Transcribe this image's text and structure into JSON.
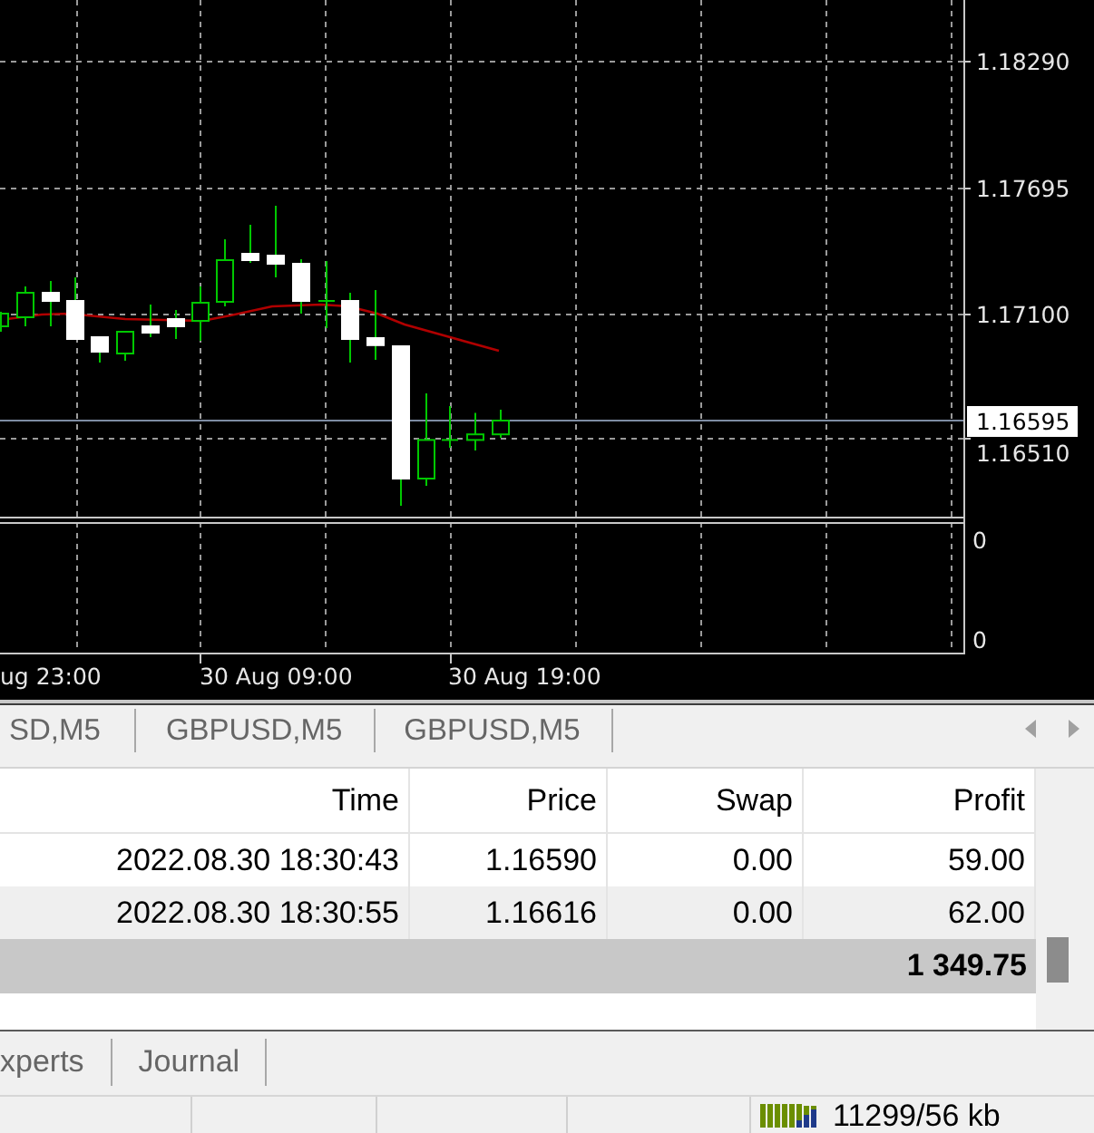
{
  "chart": {
    "price_labels": [
      "1.18290",
      "1.17695",
      "1.17100",
      "1.16510"
    ],
    "current_price": "1.16595",
    "indicator_labels": [
      "0",
      "0"
    ],
    "time_labels": [
      "ug 23:00",
      "30 Aug 09:00",
      "30 Aug 19:00"
    ]
  },
  "chart_tabs": [
    {
      "label": "SD,M5",
      "selected": false
    },
    {
      "label": "GBPUSD,M5",
      "selected": false
    },
    {
      "label": "GBPUSD,M5",
      "selected": false
    }
  ],
  "table": {
    "columns": [
      "Time",
      "Price",
      "Swap",
      "Profit"
    ],
    "rows": [
      [
        "2022.08.30 18:30:43",
        "1.16590",
        "0.00",
        "59.00"
      ],
      [
        "2022.08.30 18:30:55",
        "1.16616",
        "0.00",
        "62.00"
      ]
    ],
    "total": "1 349.75"
  },
  "terminal_tabs": [
    {
      "label": "xperts",
      "selected": false
    },
    {
      "label": "Journal",
      "selected": false
    }
  ],
  "status_bar": {
    "traffic": "11299/56 kb"
  }
}
